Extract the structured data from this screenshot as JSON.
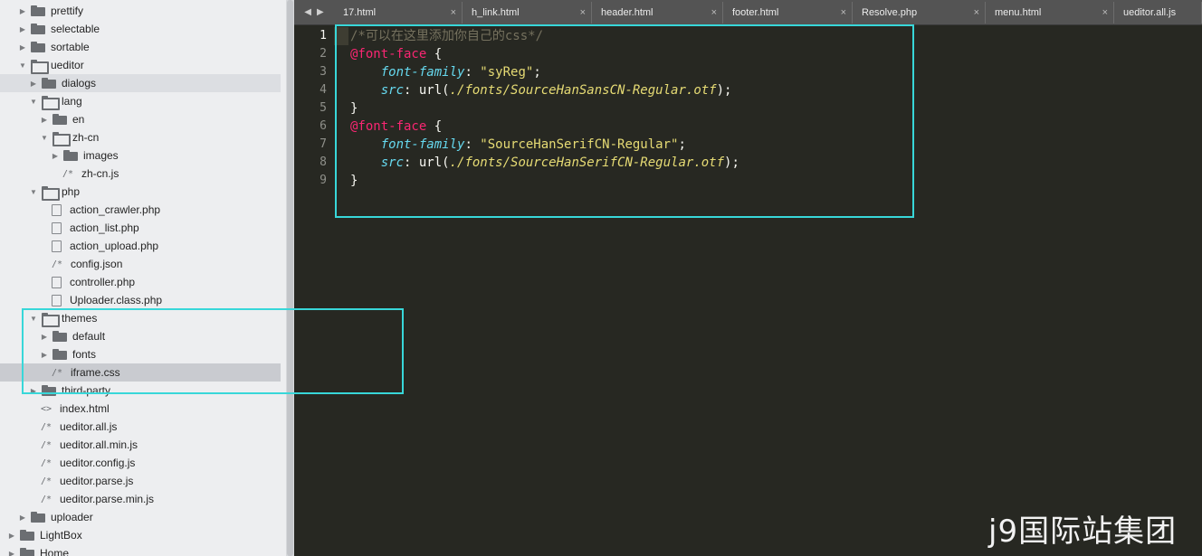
{
  "sidebar": {
    "rows": [
      {
        "label": "prettify",
        "kind": "folder",
        "arrow": "collapsed",
        "depth": 1
      },
      {
        "label": "selectable",
        "kind": "folder",
        "arrow": "collapsed",
        "depth": 1
      },
      {
        "label": "sortable",
        "kind": "folder",
        "arrow": "collapsed",
        "depth": 1
      },
      {
        "label": "ueditor",
        "kind": "folder",
        "arrow": "expanded",
        "depth": 1
      },
      {
        "label": "dialogs",
        "kind": "folder",
        "arrow": "collapsed",
        "depth": 2,
        "state": "hover"
      },
      {
        "label": "lang",
        "kind": "folder",
        "arrow": "expanded",
        "depth": 2
      },
      {
        "label": "en",
        "kind": "folder",
        "arrow": "collapsed",
        "depth": 3
      },
      {
        "label": "zh-cn",
        "kind": "folder",
        "arrow": "expanded",
        "depth": 3
      },
      {
        "label": "images",
        "kind": "folder",
        "arrow": "collapsed",
        "depth": 4
      },
      {
        "label": "zh-cn.js",
        "kind": "code",
        "glyph": "/*",
        "depth": 4
      },
      {
        "label": "php",
        "kind": "folder",
        "arrow": "expanded",
        "depth": 2
      },
      {
        "label": "action_crawler.php",
        "kind": "doc",
        "depth": 3
      },
      {
        "label": "action_list.php",
        "kind": "doc",
        "depth": 3
      },
      {
        "label": "action_upload.php",
        "kind": "doc",
        "depth": 3
      },
      {
        "label": "config.json",
        "kind": "code",
        "glyph": "/*",
        "depth": 3
      },
      {
        "label": "controller.php",
        "kind": "doc",
        "depth": 3
      },
      {
        "label": "Uploader.class.php",
        "kind": "doc",
        "depth": 3
      },
      {
        "label": "themes",
        "kind": "folder",
        "arrow": "expanded",
        "depth": 2
      },
      {
        "label": "default",
        "kind": "folder",
        "arrow": "collapsed",
        "depth": 3
      },
      {
        "label": "fonts",
        "kind": "folder",
        "arrow": "collapsed",
        "depth": 3
      },
      {
        "label": "iframe.css",
        "kind": "code",
        "glyph": "/*",
        "depth": 3,
        "state": "selected"
      },
      {
        "label": "third-party",
        "kind": "folder",
        "arrow": "collapsed",
        "depth": 2
      },
      {
        "label": "index.html",
        "kind": "code",
        "glyph": "<>",
        "depth": 2
      },
      {
        "label": "ueditor.all.js",
        "kind": "code",
        "glyph": "/*",
        "depth": 2
      },
      {
        "label": "ueditor.all.min.js",
        "kind": "code",
        "glyph": "/*",
        "depth": 2
      },
      {
        "label": "ueditor.config.js",
        "kind": "code",
        "glyph": "/*",
        "depth": 2
      },
      {
        "label": "ueditor.parse.js",
        "kind": "code",
        "glyph": "/*",
        "depth": 2
      },
      {
        "label": "ueditor.parse.min.js",
        "kind": "code",
        "glyph": "/*",
        "depth": 2
      },
      {
        "label": "uploader",
        "kind": "folder",
        "arrow": "collapsed",
        "depth": 1
      },
      {
        "label": "LightBox",
        "kind": "folder",
        "arrow": "collapsed",
        "depth": 0
      },
      {
        "label": "Home",
        "kind": "folder",
        "arrow": "collapsed",
        "depth": 0
      }
    ]
  },
  "tabbar": {
    "nav_prev": "◀",
    "nav_next": "▶",
    "tabs": [
      {
        "label": "17.html",
        "close": "×"
      },
      {
        "label": "h_link.html",
        "close": "×"
      },
      {
        "label": "header.html",
        "close": "×"
      },
      {
        "label": "footer.html",
        "close": "×"
      },
      {
        "label": "Resolve.php",
        "close": "×"
      },
      {
        "label": "menu.html",
        "close": "×"
      },
      {
        "label": "ueditor.all.js",
        "close": ""
      }
    ]
  },
  "editor": {
    "active_line": 1,
    "lines": [
      {
        "number": "1",
        "tokens": [
          {
            "t": "comment",
            "v": "/*可以在这里添加你自己的css*/"
          }
        ]
      },
      {
        "number": "2",
        "tokens": [
          {
            "t": "at",
            "v": "@font-face"
          },
          {
            "t": "plain",
            "v": " {"
          }
        ]
      },
      {
        "number": "3",
        "tokens": [
          {
            "t": "plain",
            "v": "    "
          },
          {
            "t": "prop",
            "v": "font-family"
          },
          {
            "t": "plain",
            "v": ": "
          },
          {
            "t": "str",
            "v": "\"syReg\""
          },
          {
            "t": "plain",
            "v": ";"
          }
        ]
      },
      {
        "number": "4",
        "tokens": [
          {
            "t": "plain",
            "v": "    "
          },
          {
            "t": "prop",
            "v": "src"
          },
          {
            "t": "plain",
            "v": ": url("
          },
          {
            "t": "url",
            "v": "./fonts/SourceHanSansCN-Regular.otf"
          },
          {
            "t": "plain",
            "v": ");"
          }
        ]
      },
      {
        "number": "5",
        "tokens": [
          {
            "t": "plain",
            "v": "}"
          }
        ]
      },
      {
        "number": "6",
        "tokens": [
          {
            "t": "at",
            "v": "@font-face"
          },
          {
            "t": "plain",
            "v": " {"
          }
        ]
      },
      {
        "number": "7",
        "tokens": [
          {
            "t": "plain",
            "v": "    "
          },
          {
            "t": "prop",
            "v": "font-family"
          },
          {
            "t": "plain",
            "v": ": "
          },
          {
            "t": "str",
            "v": "\"SourceHanSerifCN-Regular\""
          },
          {
            "t": "plain",
            "v": ";"
          }
        ]
      },
      {
        "number": "8",
        "tokens": [
          {
            "t": "plain",
            "v": "    "
          },
          {
            "t": "prop",
            "v": "src"
          },
          {
            "t": "plain",
            "v": ": url("
          },
          {
            "t": "url",
            "v": "./fonts/SourceHanSerifCN-Regular.otf"
          },
          {
            "t": "plain",
            "v": ");"
          }
        ]
      },
      {
        "number": "9",
        "tokens": [
          {
            "t": "plain",
            "v": "}"
          }
        ]
      }
    ]
  },
  "watermark": "j9国际站集团",
  "colors": {
    "editor_bg": "#272822",
    "highlight_box": "#38d7d9",
    "keyword": "#f92672",
    "property": "#66d9ef",
    "string": "#e6db74",
    "comment": "#75715e"
  }
}
